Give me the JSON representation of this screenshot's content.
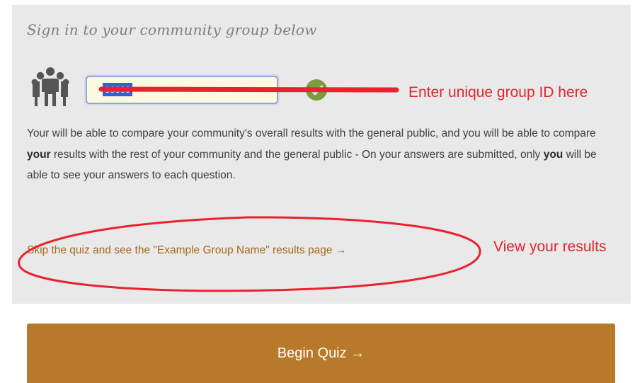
{
  "form": {
    "heading": "Sign in to your community group below",
    "group_id_value": "00000",
    "description_parts": [
      "Your will be able to compare your community's overall results with the general public, and you will be able to compare ",
      "your",
      " results with the rest of your community and the general public - On your answers are submitted, only ",
      "you",
      " will be able to see your answers to each question."
    ],
    "skip_link": "Skip the quiz and see the \"Example Group Name\" results page →",
    "begin_button": "Begin Quiz →"
  },
  "annotations": {
    "group_id_hint": "Enter unique group ID here",
    "results_hint": "View your results",
    "color": "#e8232f"
  },
  "icons": {
    "group": "people-group-icon",
    "valid": "check-circle-icon"
  },
  "colors": {
    "panel_bg": "#e9e9ea",
    "accent": "#b9792a",
    "link": "#a5691a",
    "check": "#7c9b3c"
  }
}
